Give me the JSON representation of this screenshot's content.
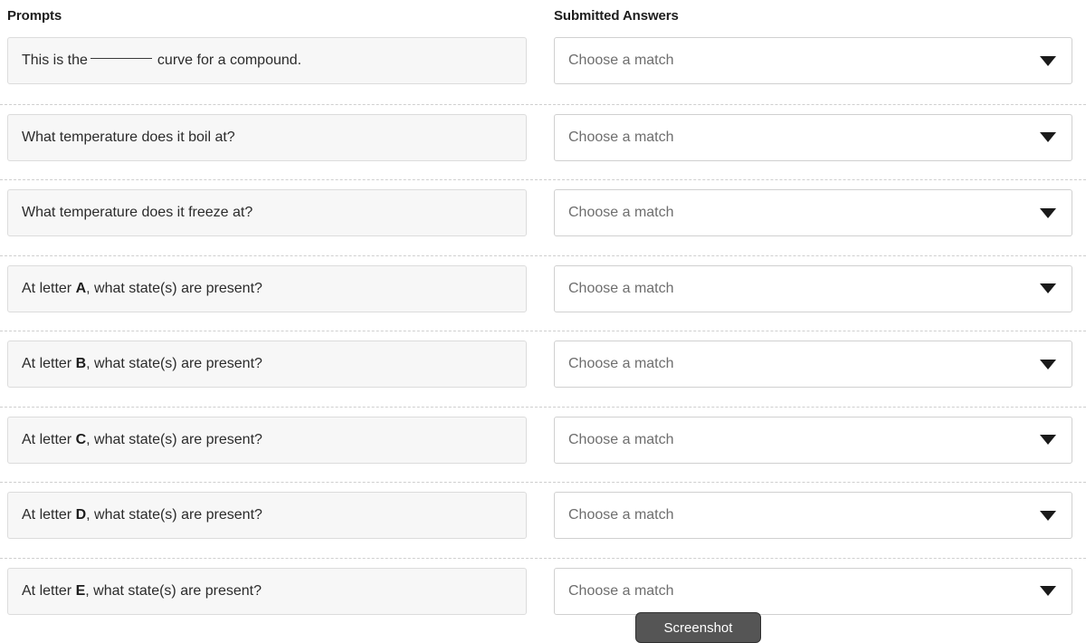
{
  "headers": {
    "prompts": "Prompts",
    "answers": "Submitted Answers"
  },
  "select_placeholder": "Choose a match",
  "caret_icon": "chevron-down-icon",
  "rows": [
    {
      "prompt_pre": "This is the",
      "prompt_blank": true,
      "prompt_post": "curve for a compound.",
      "answer": "Choose a match"
    },
    {
      "prompt_pre": "What temperature does it boil at?",
      "prompt_blank": false,
      "prompt_post": "",
      "answer": "Choose a match"
    },
    {
      "prompt_pre": "What temperature does it freeze at?",
      "prompt_blank": false,
      "prompt_post": "",
      "answer": "Choose a match"
    },
    {
      "prompt_pre": "At letter",
      "prompt_bold": "A",
      "prompt_post": ", what state(s) are present?",
      "answer": "Choose a match"
    },
    {
      "prompt_pre": "At letter",
      "prompt_bold": "B",
      "prompt_post": ", what state(s) are present?",
      "answer": "Choose a match"
    },
    {
      "prompt_pre": "At letter",
      "prompt_bold": "C",
      "prompt_post": ", what state(s) are present?",
      "answer": "Choose a match"
    },
    {
      "prompt_pre": "At letter",
      "prompt_bold": "D",
      "prompt_post": ", what state(s) are present?",
      "answer": "Choose a match"
    },
    {
      "prompt_pre": "At letter",
      "prompt_bold": "E",
      "prompt_post": ", what state(s) are present?",
      "answer": "Choose a match"
    }
  ],
  "screenshot_button": {
    "label": "Screenshot"
  },
  "colors": {
    "prompt_bg": "#f7f7f7",
    "prompt_border": "#dcdcdc",
    "select_bg": "#ffffff",
    "select_border": "#d0d0d0",
    "divider": "#cfcfcf",
    "placeholder_text": "#6e6e6e",
    "heading_text": "#1d1d1d",
    "button_bg": "#555555"
  }
}
